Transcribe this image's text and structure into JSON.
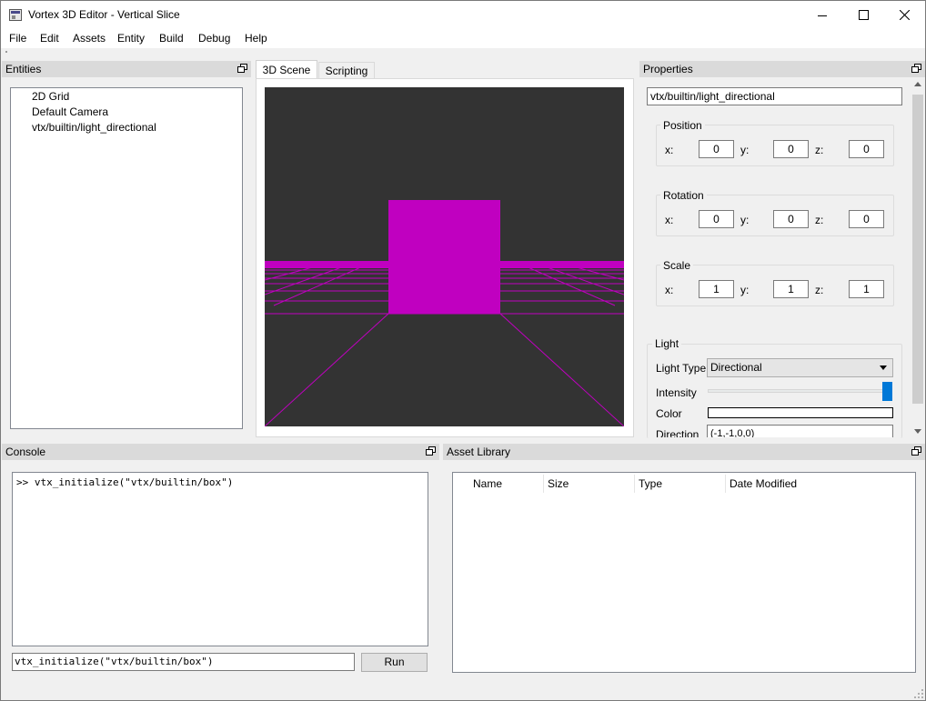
{
  "window": {
    "title": "Vortex 3D Editor - Vertical Slice"
  },
  "menu": [
    "File",
    "Edit",
    "Assets",
    "Entity",
    "Build",
    "Debug",
    "Help"
  ],
  "entities_panel": {
    "title": "Entities",
    "items": [
      "2D Grid",
      "Default Camera",
      "vtx/builtin/light_directional"
    ]
  },
  "center": {
    "tabs": [
      "3D Scene",
      "Scripting"
    ],
    "active_tab": "3D Scene"
  },
  "colors": {
    "scene_bg": "#333333",
    "accent": "#c000c0",
    "selection": "#0078d7"
  },
  "properties": {
    "title": "Properties",
    "entity_name": "vtx/builtin/light_directional",
    "position": {
      "label": "Position",
      "x": "0",
      "y": "0",
      "z": "0"
    },
    "rotation": {
      "label": "Rotation",
      "x": "0",
      "y": "0",
      "z": "0"
    },
    "scale": {
      "label": "Scale",
      "x": "1",
      "y": "1",
      "z": "1"
    },
    "axis_labels": {
      "x": "x:",
      "y": "y:",
      "z": "z:"
    },
    "light": {
      "label": "Light",
      "type_label": "Light Type",
      "type_value": "Directional",
      "intensity_label": "Intensity",
      "intensity": 1.0,
      "color_label": "Color",
      "color_value": "#ffffff",
      "direction_label": "Direction",
      "direction_value": "(-1,-1,0,0)"
    }
  },
  "console": {
    "title": "Console",
    "output_line": ">> vtx_initialize(\"vtx/builtin/box\")",
    "input_value": "vtx_initialize(\"vtx/builtin/box\")",
    "run_label": "Run"
  },
  "assets": {
    "title": "Asset Library",
    "columns": [
      "Name",
      "Size",
      "Type",
      "Date Modified"
    ]
  }
}
